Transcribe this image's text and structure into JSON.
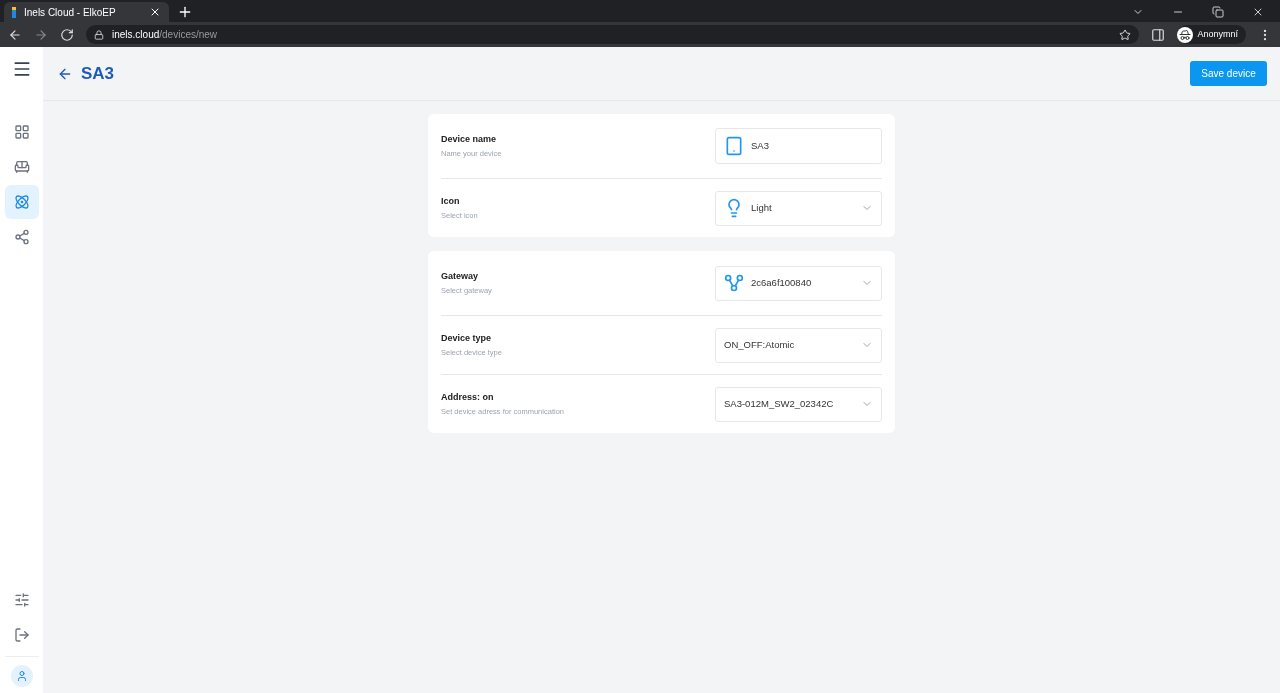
{
  "browser": {
    "tab_title": "Inels Cloud - ElkoEP",
    "url_host": "inels.cloud",
    "url_path": "/devices/new",
    "profile": "Anonymní"
  },
  "sidebar": {
    "items": [
      {
        "selected": false
      },
      {
        "selected": false
      },
      {
        "selected": true
      },
      {
        "selected": false
      }
    ],
    "bottom": [
      {
        "selected": false
      },
      {
        "selected": false
      }
    ]
  },
  "header": {
    "title": "SA3",
    "save_button": "Save device"
  },
  "cards": [
    {
      "rows": [
        {
          "label": "Device name",
          "hint": "Name your device",
          "kind": "name",
          "value": "SA3"
        },
        {
          "label": "Icon",
          "hint": "Select icon",
          "kind": "icon_select",
          "value": "Light"
        }
      ]
    },
    {
      "rows": [
        {
          "label": "Gateway",
          "hint": "Select gateway",
          "kind": "gateway_select",
          "value": "2c6a6f100840"
        },
        {
          "label": "Device type",
          "hint": "Select device type",
          "kind": "select",
          "value": "ON_OFF:Atomic"
        },
        {
          "label": "Address: on",
          "hint": "Set device adress for communication",
          "kind": "select",
          "value": "SA3-012M_SW2_02342C"
        }
      ]
    }
  ]
}
